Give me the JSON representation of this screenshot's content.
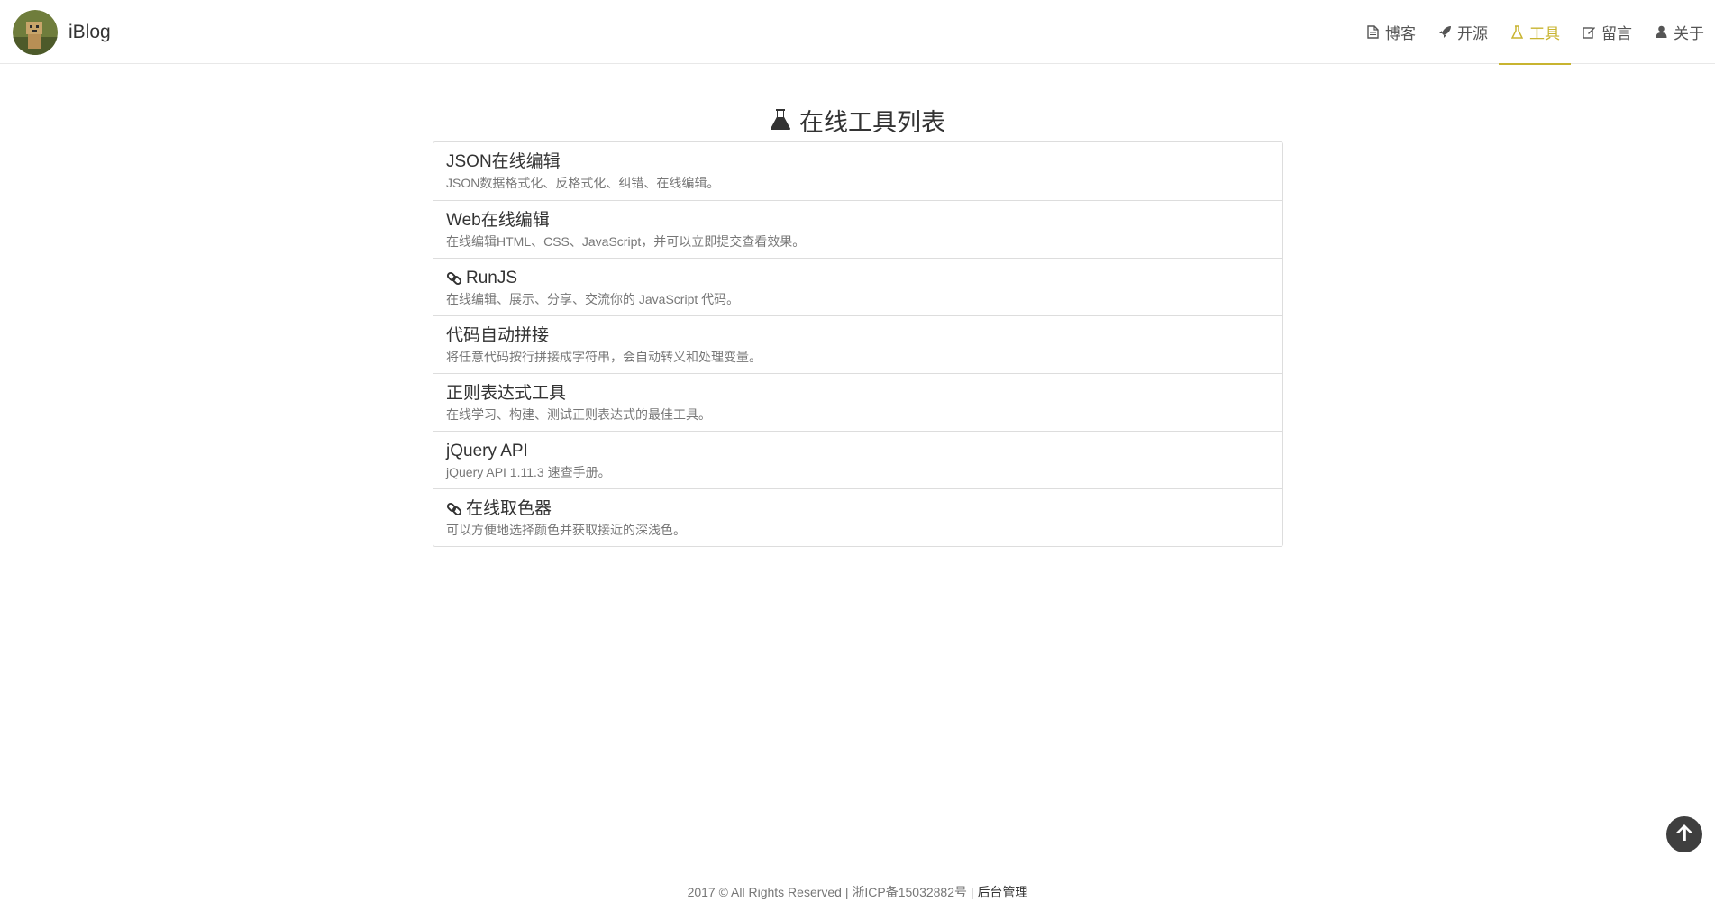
{
  "brand": {
    "name": "iBlog"
  },
  "nav": {
    "items": [
      {
        "label": "博客",
        "icon": "document-icon",
        "active": false
      },
      {
        "label": "开源",
        "icon": "rocket-icon",
        "active": false
      },
      {
        "label": "工具",
        "icon": "flask-icon",
        "active": true
      },
      {
        "label": "留言",
        "icon": "edit-icon",
        "active": false
      },
      {
        "label": "关于",
        "icon": "user-icon",
        "active": false
      }
    ]
  },
  "colors": {
    "accent": "#c8b430",
    "border": "#dddddd",
    "text": "#333333",
    "muted": "#777777"
  },
  "page": {
    "title": "在线工具列表",
    "title_icon": "flask-icon"
  },
  "tools": [
    {
      "title": "JSON在线编辑",
      "desc": "JSON数据格式化、反格式化、纠错、在线编辑。",
      "external": false
    },
    {
      "title": "Web在线编辑",
      "desc": "在线编辑HTML、CSS、JavaScript，并可以立即提交查看效果。",
      "external": false
    },
    {
      "title": "RunJS",
      "desc": "在线编辑、展示、分享、交流你的 JavaScript 代码。",
      "external": true
    },
    {
      "title": "代码自动拼接",
      "desc": "将任意代码按行拼接成字符串，会自动转义和处理变量。",
      "external": false
    },
    {
      "title": "正则表达式工具",
      "desc": "在线学习、构建、测试正则表达式的最佳工具。",
      "external": false
    },
    {
      "title": "jQuery API",
      "desc": "jQuery API 1.11.3 速查手册。",
      "external": false
    },
    {
      "title": "在线取色器",
      "desc": "可以方便地选择颜色并获取接近的深浅色。",
      "external": true
    }
  ],
  "footer": {
    "text": "2017 © All Rights Reserved | 浙ICP备15032882号 | ",
    "admin_link": "后台管理"
  },
  "back_to_top": {
    "icon": "arrow-up-icon"
  }
}
